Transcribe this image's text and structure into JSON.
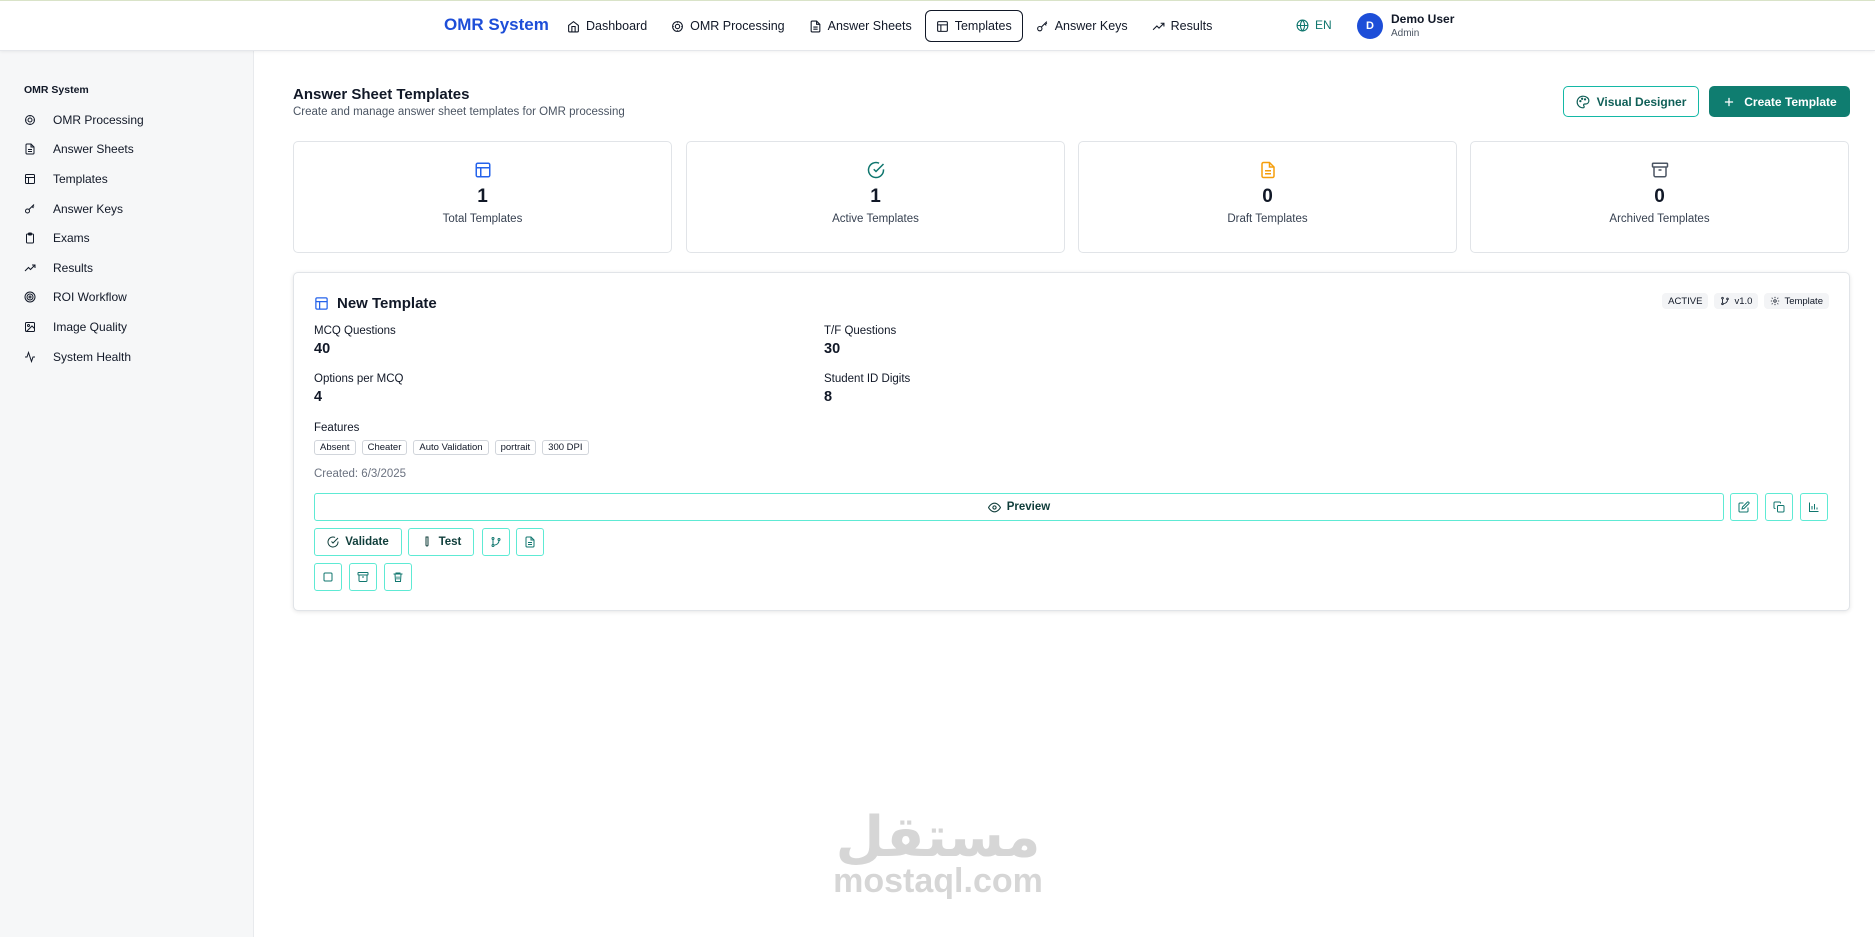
{
  "topnav": {
    "brand": "OMR System",
    "items": [
      {
        "label": "Dashboard",
        "icon": "home-icon"
      },
      {
        "label": "OMR Processing",
        "icon": "scan-icon"
      },
      {
        "label": "Answer Sheets",
        "icon": "document-icon"
      },
      {
        "label": "Templates",
        "icon": "layout-icon",
        "active": true
      },
      {
        "label": "Answer Keys",
        "icon": "key-icon"
      },
      {
        "label": "Results",
        "icon": "trend-icon"
      }
    ],
    "language": "EN",
    "user": {
      "initial": "D",
      "name": "Demo User",
      "role": "Admin"
    }
  },
  "sidebar": {
    "title": "OMR System",
    "items": [
      {
        "label": "OMR Processing",
        "icon": "scan-icon"
      },
      {
        "label": "Answer Sheets",
        "icon": "document-icon"
      },
      {
        "label": "Templates",
        "icon": "layout-icon"
      },
      {
        "label": "Answer Keys",
        "icon": "key-icon"
      },
      {
        "label": "Exams",
        "icon": "clipboard-icon"
      },
      {
        "label": "Results",
        "icon": "trend-icon"
      },
      {
        "label": "ROI Workflow",
        "icon": "target-icon"
      },
      {
        "label": "Image Quality",
        "icon": "image-icon"
      },
      {
        "label": "System Health",
        "icon": "activity-icon"
      }
    ]
  },
  "header": {
    "title": "Answer Sheet Templates",
    "subtitle": "Create and manage answer sheet templates for OMR processing",
    "visual_designer": "Visual Designer",
    "create_template": "Create Template"
  },
  "stats": [
    {
      "value": "1",
      "label": "Total Templates",
      "icon": "layout-icon",
      "color": "#2563eb"
    },
    {
      "value": "1",
      "label": "Active Templates",
      "icon": "check-circle-icon",
      "color": "#0f766e"
    },
    {
      "value": "0",
      "label": "Draft Templates",
      "icon": "file-text-icon",
      "color": "#f59e0b"
    },
    {
      "value": "0",
      "label": "Archived Templates",
      "icon": "archive-icon",
      "color": "#4b5563"
    }
  ],
  "template": {
    "name": "New Template",
    "badges": {
      "status": "ACTIVE",
      "version": "v1.0",
      "type": "Template"
    },
    "mcq_label": "MCQ Questions",
    "mcq_value": "40",
    "tf_label": "T/F Questions",
    "tf_value": "30",
    "options_label": "Options per MCQ",
    "options_value": "4",
    "student_id_label": "Student ID Digits",
    "student_id_value": "8",
    "features_label": "Features",
    "features": [
      "Absent",
      "Cheater",
      "Auto Validation",
      "portrait",
      "300 DPI"
    ],
    "created": "Created: 6/3/2025",
    "preview": "Preview",
    "validate": "Validate",
    "test": "Test"
  },
  "watermark": {
    "arabic": "مستقل",
    "latin": "mostaql.com"
  }
}
